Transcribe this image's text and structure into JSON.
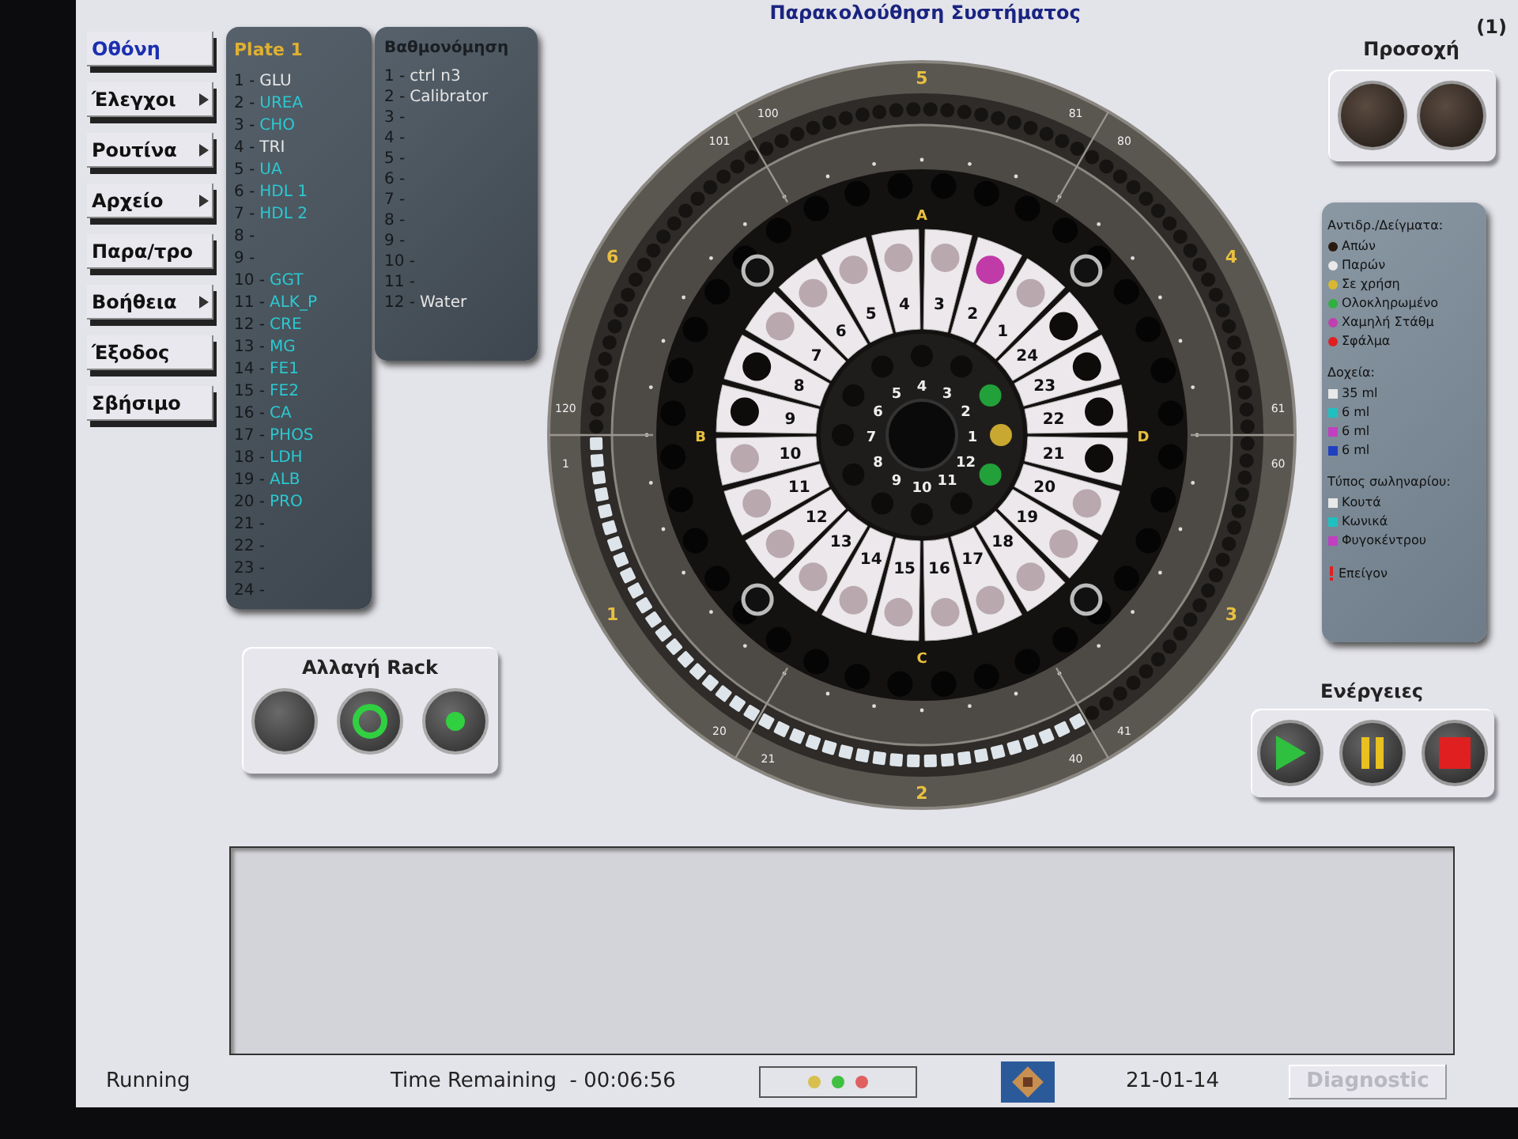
{
  "title": "Παρακολούθηση Συστήματος",
  "screen_number": "(1)",
  "menu": [
    {
      "label": "Οθόνη",
      "selected": true,
      "submenu": false
    },
    {
      "label": "Έλεγχοι",
      "selected": false,
      "submenu": true
    },
    {
      "label": "Ρουτίνα",
      "selected": false,
      "submenu": true
    },
    {
      "label": "Αρχείο",
      "selected": false,
      "submenu": true
    },
    {
      "label": "Παρα/τρο",
      "selected": false,
      "submenu": false
    },
    {
      "label": "Βοήθεια",
      "selected": false,
      "submenu": true
    },
    {
      "label": "Έξοδος",
      "selected": false,
      "submenu": false
    },
    {
      "label": "Σβήσιμο",
      "selected": false,
      "submenu": false
    }
  ],
  "plate": {
    "title": "Plate 1",
    "items": [
      {
        "index": "1 -",
        "name": "GLU",
        "color": "#e6e6e6"
      },
      {
        "index": "2 -",
        "name": "UREA",
        "color": "#2cc8d0"
      },
      {
        "index": "3 -",
        "name": "CHO",
        "color": "#2cc8d0"
      },
      {
        "index": "4 -",
        "name": "TRI",
        "color": "#e6e6e6"
      },
      {
        "index": "5 -",
        "name": "UA",
        "color": "#2cc8d0"
      },
      {
        "index": "6 -",
        "name": "HDL 1",
        "color": "#2cc8d0"
      },
      {
        "index": "7 -",
        "name": "HDL 2",
        "color": "#2cc8d0"
      },
      {
        "index": "8 -"
      },
      {
        "index": "9 -"
      },
      {
        "index": "10 -",
        "name": "GGT",
        "color": "#2cc8d0"
      },
      {
        "index": "11 -",
        "name": "ALK_P",
        "color": "#2cc8d0"
      },
      {
        "index": "12 -",
        "name": "CRE",
        "color": "#2cc8d0"
      },
      {
        "index": "13 -",
        "name": "MG",
        "color": "#2cc8d0"
      },
      {
        "index": "14 -",
        "name": "FE1",
        "color": "#2cc8d0"
      },
      {
        "index": "15 -",
        "name": "FE2",
        "color": "#2cc8d0"
      },
      {
        "index": "16 -",
        "name": "CA",
        "color": "#2cc8d0"
      },
      {
        "index": "17 -",
        "name": "PHOS",
        "color": "#2cc8d0"
      },
      {
        "index": "18 -",
        "name": "LDH",
        "color": "#2cc8d0"
      },
      {
        "index": "19 -",
        "name": "ALB",
        "color": "#2cc8d0"
      },
      {
        "index": "20 -",
        "name": "PRO",
        "color": "#2cc8d0"
      },
      {
        "index": "21 -"
      },
      {
        "index": "22 -"
      },
      {
        "index": "23 -"
      },
      {
        "index": "24 -"
      }
    ]
  },
  "calibration": {
    "title": "Βαθμονόμηση",
    "items": [
      {
        "index": "1 -",
        "name": "ctrl n3"
      },
      {
        "index": "2 -",
        "name": "Calibrator"
      },
      {
        "index": "3 -"
      },
      {
        "index": "4 -"
      },
      {
        "index": "5 -"
      },
      {
        "index": "6 -"
      },
      {
        "index": "7 -"
      },
      {
        "index": "8 -"
      },
      {
        "index": "9 -"
      },
      {
        "index": "10 -"
      },
      {
        "index": "11 -"
      },
      {
        "index": "12 -",
        "name": "Water"
      }
    ]
  },
  "wheel": {
    "segments": [
      {
        "label": "5",
        "loaded": false
      },
      {
        "label": "6",
        "loaded": false
      },
      {
        "label": "4",
        "loaded": false
      },
      {
        "label": "1",
        "loaded": true
      },
      {
        "label": "3",
        "loaded": false
      },
      {
        "label": "2",
        "loaded": true
      }
    ],
    "dividers": [
      [
        "100",
        "101"
      ],
      [
        "81",
        "80"
      ],
      [
        "120",
        "1"
      ],
      [
        "61",
        "60"
      ],
      [
        "20",
        "21"
      ],
      [
        "41",
        "40"
      ]
    ],
    "sectors": [
      "A",
      "B",
      "D",
      "C"
    ],
    "reagents": [
      {
        "number": "1",
        "color": "#b9a9ae"
      },
      {
        "number": "2",
        "color": "#c03aa8"
      },
      {
        "number": "3",
        "color": "#b9a9ae"
      },
      {
        "number": "4",
        "color": "#b9a9ae"
      },
      {
        "number": "5",
        "color": "#b9a9ae"
      },
      {
        "number": "6",
        "color": "#b9a9ae"
      },
      {
        "number": "7",
        "color": "#b9a9ae"
      },
      {
        "number": "8",
        "color": "#0e0c0b"
      },
      {
        "number": "9",
        "color": "#0e0c0b"
      },
      {
        "number": "10",
        "color": "#b9a9ae"
      },
      {
        "number": "11",
        "color": "#b9a9ae"
      },
      {
        "number": "12",
        "color": "#b9a9ae"
      },
      {
        "number": "13",
        "color": "#b9a9ae"
      },
      {
        "number": "14",
        "color": "#b9a9ae"
      },
      {
        "number": "15",
        "color": "#b9a9ae"
      },
      {
        "number": "16",
        "color": "#b9a9ae"
      },
      {
        "number": "17",
        "color": "#b9a9ae"
      },
      {
        "number": "18",
        "color": "#b9a9ae"
      },
      {
        "number": "19",
        "color": "#b9a9ae"
      },
      {
        "number": "20",
        "color": "#b9a9ae"
      },
      {
        "number": "21",
        "color": "#0e0c0b"
      },
      {
        "number": "22",
        "color": "#0e0c0b"
      },
      {
        "number": "23",
        "color": "#0e0c0b"
      },
      {
        "number": "24",
        "color": "#0e0c0b"
      }
    ],
    "inner": [
      {
        "number": "1",
        "color": "#c8a830"
      },
      {
        "number": "2",
        "color": "#22a03a"
      },
      {
        "number": "3",
        "color": "#0e0c0b"
      },
      {
        "number": "4",
        "color": "#0e0c0b"
      },
      {
        "number": "5",
        "color": "#0e0c0b"
      },
      {
        "number": "6",
        "color": "#0e0c0b"
      },
      {
        "number": "7",
        "color": "#0e0c0b"
      },
      {
        "number": "8",
        "color": "#0e0c0b"
      },
      {
        "number": "9",
        "color": "#0e0c0b"
      },
      {
        "number": "10",
        "color": "#0e0c0b"
      },
      {
        "number": "11",
        "color": "#0e0c0b"
      },
      {
        "number": "12",
        "color": "#22a03a"
      }
    ]
  },
  "rack": {
    "title": "Αλλαγή Rack",
    "buttons": [
      {
        "kind": "off"
      },
      {
        "kind": "ring"
      },
      {
        "kind": "dot"
      }
    ]
  },
  "attention": {
    "title": "Προσοχή",
    "lamps": [
      {
        "on": false
      },
      {
        "on": false
      }
    ]
  },
  "legend": {
    "title": "Αντιδρ./Δείγματα:",
    "states": [
      {
        "label": "Απών",
        "color": "#2a1a10"
      },
      {
        "label": "Παρών",
        "color": "#e8e8e8"
      },
      {
        "label": "Σε χρήση",
        "color": "#d8b830"
      },
      {
        "label": "Ολοκληρωμένο",
        "color": "#30b040"
      },
      {
        "label": "Χαμηλή Στάθμ",
        "color": "#c040b0"
      },
      {
        "label": "Σφάλμα",
        "color": "#e02020"
      }
    ],
    "containers_title": "Δοχεία:",
    "containers": [
      {
        "label": "35 ml",
        "color": "#e8e8e8"
      },
      {
        "label": "6 ml",
        "color": "#20c0c0"
      },
      {
        "label": "6 ml",
        "color": "#c040c0"
      },
      {
        "label": "6 ml",
        "color": "#2040c0"
      }
    ],
    "tubes_title": "Τύπος σωληναρίου:",
    "tubes": [
      {
        "label": "Κουτά",
        "color": "#e8e8e8"
      },
      {
        "label": "Κωνικά",
        "color": "#20c0c0"
      },
      {
        "label": "Φυγοκέντρου",
        "color": "#c040c0"
      }
    ],
    "urgent": {
      "label": "Επείγον",
      "color": "#e02020"
    }
  },
  "actions": {
    "title": "Ενέργειες",
    "buttons": [
      {
        "kind": "play"
      },
      {
        "kind": "pause"
      },
      {
        "kind": "stop"
      }
    ]
  },
  "status_bar": {
    "state": "Running",
    "time_remaining": "Time Remaining  - 00:06:56",
    "indicators": [
      {
        "color": "#d8c050"
      },
      {
        "color": "#40c040"
      },
      {
        "color": "#e06060"
      }
    ],
    "date": "21-01-14",
    "diagnostic": {
      "label": "Diagnostic",
      "disabled": true
    }
  }
}
